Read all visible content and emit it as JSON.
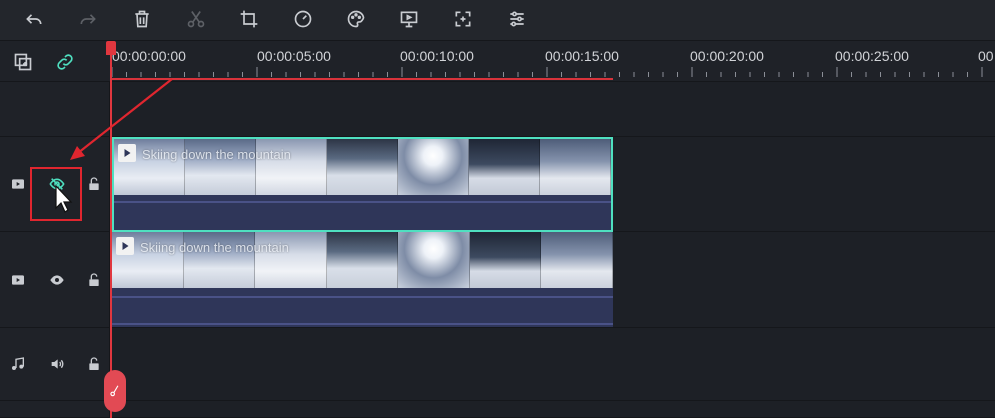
{
  "toolbar": {
    "buttons": [
      {
        "name": "undo",
        "icon": "undo-icon",
        "enabled": true
      },
      {
        "name": "redo",
        "icon": "redo-icon",
        "enabled": false
      },
      {
        "name": "delete",
        "icon": "trash-icon",
        "enabled": true
      },
      {
        "name": "cut",
        "icon": "scissors-icon",
        "enabled": false
      },
      {
        "name": "crop",
        "icon": "crop-icon",
        "enabled": true
      },
      {
        "name": "speed",
        "icon": "speedometer-icon",
        "enabled": true
      },
      {
        "name": "color",
        "icon": "palette-icon",
        "enabled": true
      },
      {
        "name": "green-screen",
        "icon": "presentation-icon",
        "enabled": true
      },
      {
        "name": "fit",
        "icon": "fit-frame-icon",
        "enabled": true
      },
      {
        "name": "adjust",
        "icon": "sliders-icon",
        "enabled": true
      }
    ]
  },
  "timeline": {
    "header": {
      "add_track_icon": "add-track-icon",
      "link_icon": "link-icon"
    },
    "ruler": {
      "labels": [
        "00:00:00:00",
        "00:00:05:00",
        "00:00:10:00",
        "00:00:15:00",
        "00:00:20:00",
        "00:00:25:00",
        "00"
      ]
    },
    "tracks": [
      {
        "kind": "video",
        "type_icon": "video-track-icon",
        "visibility_icon": "eye-hidden-icon",
        "lock_icon": "unlock-icon",
        "clip": {
          "title": "Skiing down the mountain",
          "selected": true
        }
      },
      {
        "kind": "video",
        "type_icon": "video-track-icon",
        "visibility_icon": "eye-icon",
        "lock_icon": "unlock-icon",
        "clip": {
          "title": "Skiing down the mountain",
          "selected": false
        }
      },
      {
        "kind": "audio",
        "type_icon": "music-note-icon",
        "visibility_icon": "speaker-icon",
        "lock_icon": "unlock-icon"
      }
    ]
  },
  "colors": {
    "accent_teal": "#4fe0c0",
    "playhead_red": "#e0373f",
    "annotation_red": "#e0262f",
    "clip_bg": "#2f3659"
  }
}
